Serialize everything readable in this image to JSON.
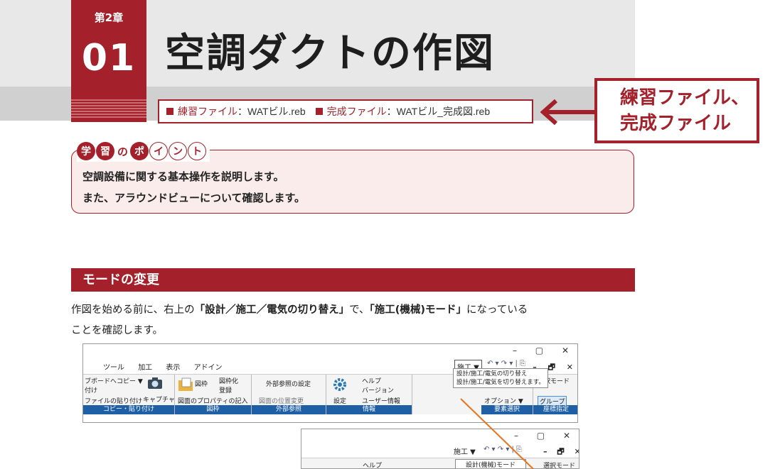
{
  "chapter": {
    "label": "第2章",
    "number": "01"
  },
  "title": "空調ダクトの作図",
  "files": {
    "practice_label": "練習ファイル",
    "practice_value": "：WATビル.reb",
    "complete_label": "完成ファイル",
    "complete_value": "：WATビル_完成図.reb"
  },
  "callout": {
    "line1": "練習ファイル、",
    "line2": "完成ファイル"
  },
  "point": {
    "tag_chars": [
      "学",
      "習",
      "の",
      "ポ",
      "イ",
      "ン",
      "ト"
    ],
    "line1": "空調設備に関する基本操作を説明します。",
    "line2": "また、アラウンドビューについて確認します。"
  },
  "section": {
    "title": "モードの変更"
  },
  "body": {
    "p1": "作図を始める前に、右上の",
    "b1": "「設計／施工／電気の切り替え」",
    "p2": "で、",
    "b2": "「施工(機械)モード」",
    "p3": "になっている",
    "p4": "ことを確認します。"
  },
  "screenshot1": {
    "window_controls": [
      "–",
      "▢",
      "✕"
    ],
    "menu": [
      "ツール",
      "加工",
      "表示",
      "アドイン"
    ],
    "mode_select": "施工 ▼",
    "quick_access": "↶ ▾ ↷ ▾ | ⎘",
    "mini_controls": [
      "–",
      "🗗",
      "✕"
    ],
    "tooltip_line1": "設計/施工/電気の切り替え",
    "tooltip_line2": "設計/施工/電気を切り替えます。",
    "groups": [
      {
        "label": "コピー・貼り付け",
        "items": [
          "ブボードへコピー ▼",
          "付け",
          "ファイルの貼り付け"
        ],
        "camera": "キャプチャ"
      },
      {
        "label": "図枠",
        "items": [
          "図枠",
          "図枠化",
          "登録",
          "図面のプロパティの記入"
        ]
      },
      {
        "label": "外部参照",
        "items": [
          "外部参照の設定",
          "図面の位置変更"
        ]
      },
      {
        "label": "情報",
        "items": [
          "設定",
          "ヘルプ",
          "バージョン",
          "ユーザー情報"
        ]
      },
      {
        "label": "要素選択",
        "items": [
          "オプション ▼"
        ]
      },
      {
        "label": "座標指定",
        "items": [
          "選択モード",
          "グループ"
        ]
      }
    ]
  },
  "screenshot2": {
    "window_controls": [
      "–",
      "▢",
      "✕"
    ],
    "mode_select": "施工 ▼",
    "quick_access": "↶ ▾ ↷ ▾ | ⎘",
    "mini_controls": [
      "–",
      "🗗",
      "✕"
    ],
    "help": "ヘルプ",
    "mode_item": "設計(機械)モード",
    "select_mode": "選択モード"
  }
}
